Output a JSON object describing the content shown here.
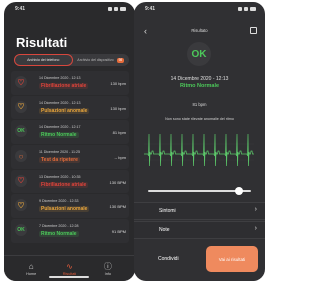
{
  "status_time": "9:41",
  "list_screen": {
    "title": "Risultati",
    "tabs": [
      {
        "label": "Archivio dei telefono",
        "active": true
      },
      {
        "label": "Archivio del dispositivo",
        "active": false,
        "badge": "98"
      }
    ],
    "rows": [
      {
        "icon": "heart-icon",
        "icon_glyph": "♡",
        "icon_color": "#e0443a",
        "date": "14 Dicembre 2020 - 12:13",
        "label": "Fibrillazione atriale",
        "label_color": "#e0443a",
        "bpm": "130 bpm"
      },
      {
        "icon": "heart-icon",
        "icon_glyph": "♡",
        "icon_color": "#e8a53c",
        "date": "14 Dicembre 2020 - 12:13",
        "label": "Pulsazioni anomale",
        "label_color": "#e8a53c",
        "bpm": "130 bpm"
      },
      {
        "icon": "ok-icon",
        "icon_glyph": "OK",
        "icon_color": "#4cc85a",
        "date": "14 Dicembre 2020 - 12:17",
        "label": "Ritmo Normale",
        "label_color": "#4cc85a",
        "bpm": "81 bpm"
      },
      {
        "icon": "alert-icon",
        "icon_glyph": "○",
        "icon_color": "#e06b3a",
        "date": "11 Dicembre 2020 - 11:25",
        "label": "Test da ripetere",
        "label_color": "#e06b3a",
        "bpm": "-- bpm"
      },
      {
        "icon": "heart-icon",
        "icon_glyph": "♡",
        "icon_color": "#e0443a",
        "date": "13 Dicembre 2020 - 10:35",
        "label": "Fibrillazione atriale",
        "label_color": "#e0443a",
        "bpm": "130 BPM"
      },
      {
        "icon": "heart-icon",
        "icon_glyph": "♡",
        "icon_color": "#e8a53c",
        "date": "9 Dicembre 2020 - 12:33",
        "label": "Pulsazioni anomale",
        "label_color": "#e8a53c",
        "bpm": "130 BPM"
      },
      {
        "icon": "ok-icon",
        "icon_glyph": "OK",
        "icon_color": "#4cc85a",
        "date": "7 Dicembre 2020 - 12:28",
        "label": "Ritmo Normale",
        "label_color": "#4cc85a",
        "bpm": "91 BPM"
      }
    ],
    "tabbar": [
      {
        "label": "Home",
        "icon": "home-icon",
        "glyph": "⌂",
        "active": false
      },
      {
        "label": "Risultati",
        "icon": "pulse-icon",
        "glyph": "∿",
        "active": true
      },
      {
        "label": "Info",
        "icon": "info-icon",
        "glyph": "ⓘ",
        "active": false
      }
    ]
  },
  "detail_screen": {
    "nav_title": "Risultato",
    "badge": "OK",
    "date": "14 Dicembre 2020 - 12:13",
    "status": "Ritmo Normale",
    "bpm": "81 bpm",
    "description": "Non sono state rilevate anomalie del ritmo",
    "playback_progress": 0.92,
    "sections": [
      {
        "label": "Sintomi"
      },
      {
        "label": "Note"
      }
    ],
    "share_label": "Condividi",
    "results_label": "Vai ai risultati"
  },
  "colors": {
    "accent": "#e45c3a",
    "normal": "#4cc85a",
    "ecg": "#5cc86a"
  }
}
